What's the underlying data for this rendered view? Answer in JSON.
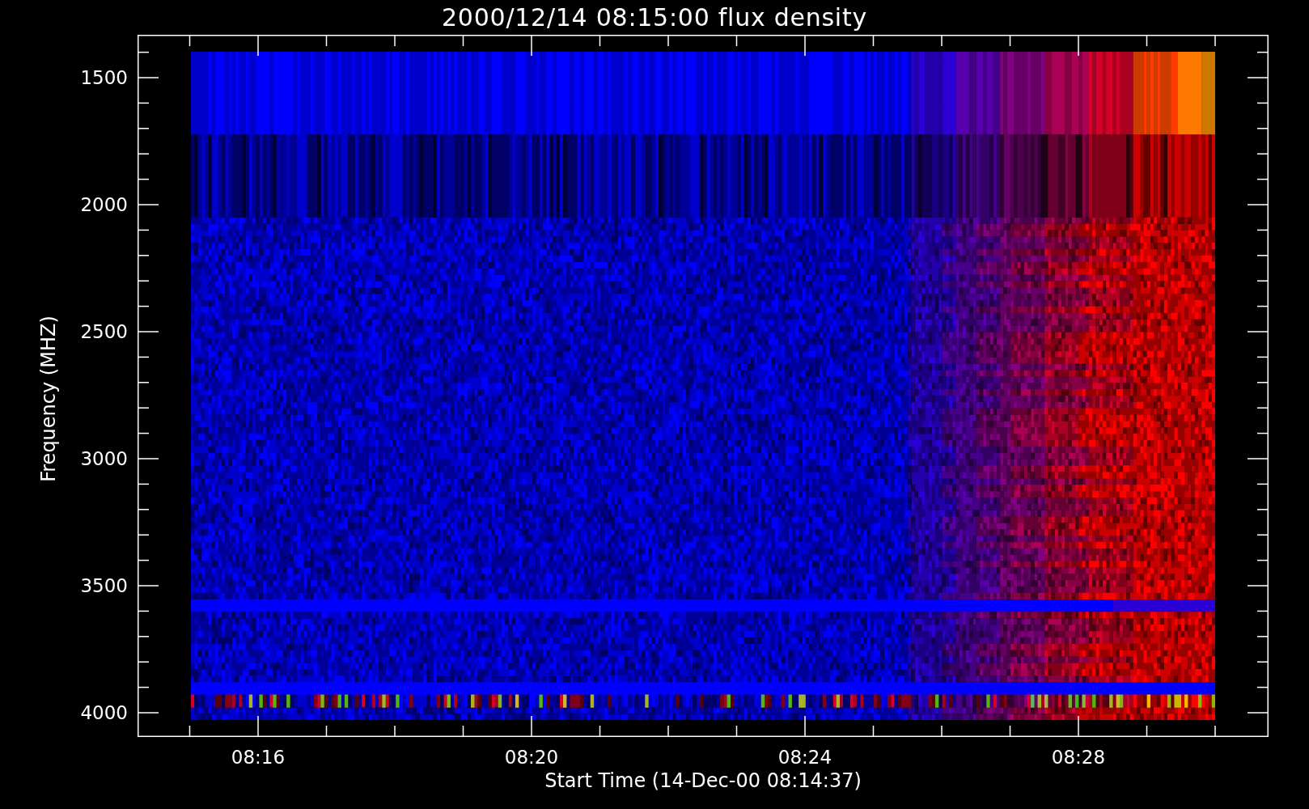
{
  "title": "2000/12/14 08:15:00 flux density",
  "chart": {
    "ylabel": "Frequency (MHZ)",
    "xlabel": "Start Time (14-Dec-00 08:14:37)",
    "yticks": [
      "1500",
      "2000",
      "2500",
      "3000",
      "3500",
      "4000"
    ],
    "xticks": [
      "08:16",
      "08:20",
      "08:24",
      "08:28"
    ]
  }
}
